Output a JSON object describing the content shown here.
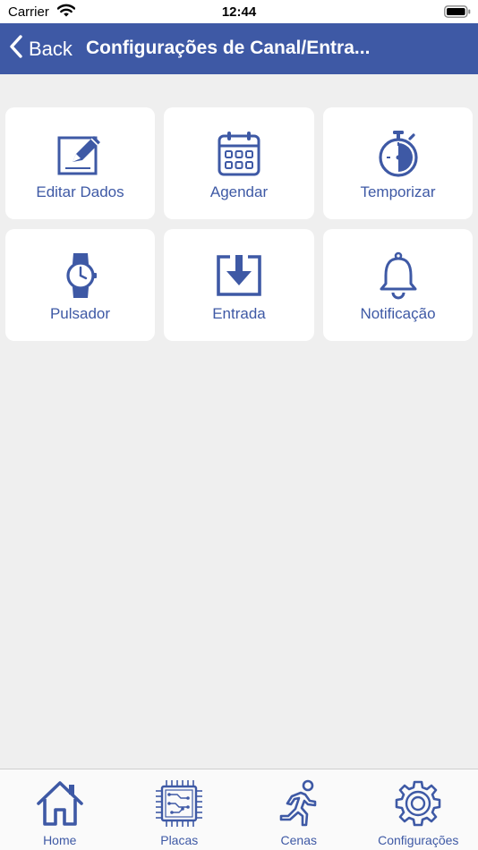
{
  "status_bar": {
    "carrier": "Carrier",
    "time": "12:44"
  },
  "nav": {
    "back_label": "Back",
    "title": "Configurações de Canal/Entra..."
  },
  "tiles": [
    {
      "label": "Editar Dados",
      "icon": "edit-icon"
    },
    {
      "label": "Agendar",
      "icon": "calendar-icon"
    },
    {
      "label": "Temporizar",
      "icon": "stopwatch-icon"
    },
    {
      "label": "Pulsador",
      "icon": "watch-icon"
    },
    {
      "label": "Entrada",
      "icon": "download-box-icon"
    },
    {
      "label": "Notificação",
      "icon": "bell-icon"
    }
  ],
  "tabs": [
    {
      "label": "Home",
      "icon": "home-icon"
    },
    {
      "label": "Placas",
      "icon": "circuit-board-icon"
    },
    {
      "label": "Cenas",
      "icon": "running-person-icon"
    },
    {
      "label": "Configurações",
      "icon": "gear-icon"
    }
  ],
  "colors": {
    "accent": "#3e59a5",
    "background": "#efefef",
    "tile": "#ffffff"
  }
}
